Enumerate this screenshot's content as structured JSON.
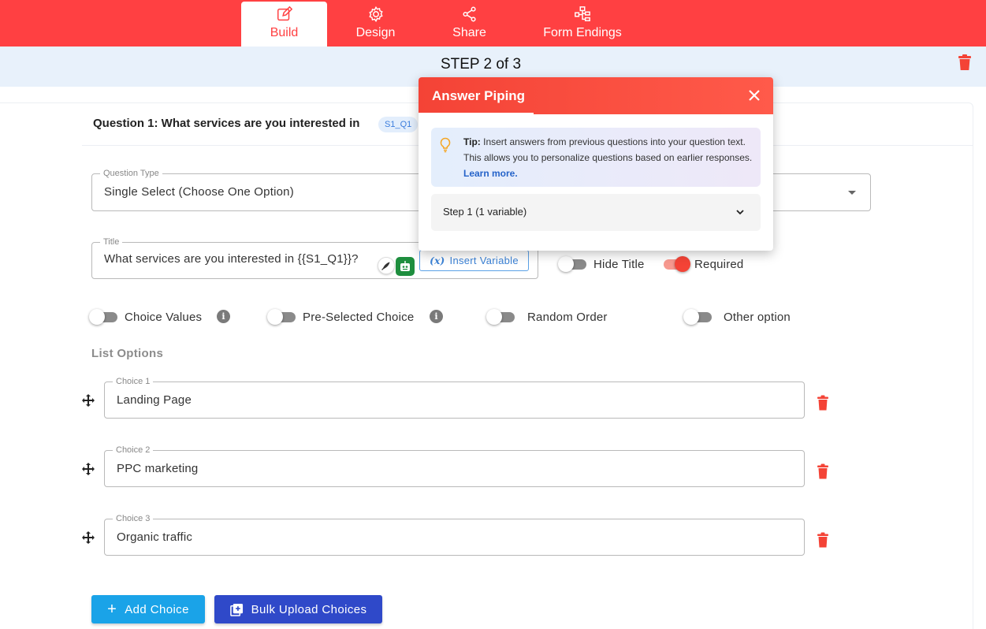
{
  "nav": {
    "tabs": [
      {
        "label": "Build",
        "icon": "edit-icon",
        "active": true
      },
      {
        "label": "Design",
        "icon": "gear-icon",
        "active": false
      },
      {
        "label": "Share",
        "icon": "share-icon",
        "active": false
      },
      {
        "label": "Form Endings",
        "icon": "flow-icon",
        "active": false
      }
    ]
  },
  "step": {
    "label": "STEP 2 of 3"
  },
  "question": {
    "header": "Question 1: What services are you interested in",
    "badge": "S1_Q1",
    "type_legend": "Question Type",
    "type_value": "Single Select (Choose One Option)",
    "title_legend": "Title",
    "title_value": "What services are you interested in {{S1_Q1}}?",
    "insert_variable_label": "Insert Variable",
    "insert_variable_icon_text": "(x)"
  },
  "toggles": {
    "hide_title": {
      "label": "Hide Title",
      "on": false
    },
    "required": {
      "label": "Required",
      "on": true
    },
    "choice_values": {
      "label": "Choice Values",
      "on": false
    },
    "preselected": {
      "label": "Pre-Selected Choice",
      "on": false
    },
    "random_order": {
      "label": "Random Order",
      "on": false
    },
    "other_option": {
      "label": "Other option",
      "on": false
    },
    "info_glyph": "i"
  },
  "list_options": {
    "title": "List Options",
    "choices": [
      {
        "legend": "Choice 1",
        "value": "Landing Page"
      },
      {
        "legend": "Choice 2",
        "value": "PPC marketing"
      },
      {
        "legend": "Choice 3",
        "value": "Organic traffic"
      }
    ]
  },
  "buttons": {
    "add_choice": "Add Choice",
    "add_choice_glyph": "+",
    "bulk_upload": "Bulk Upload Choices"
  },
  "popup": {
    "title": "Answer Piping",
    "tip_label": "Tip:",
    "tip_text": " Insert answers from previous questions into your question text. This allows you to personalize questions based on earlier responses. ",
    "tip_link": "Learn more.",
    "step_item": "Step 1 (1 variable)"
  },
  "colors": {
    "brand_red": "#ff4042",
    "step_bg": "#e8f1fb",
    "add_button": "#1aa3e8",
    "bulk_button": "#2f49c9"
  }
}
